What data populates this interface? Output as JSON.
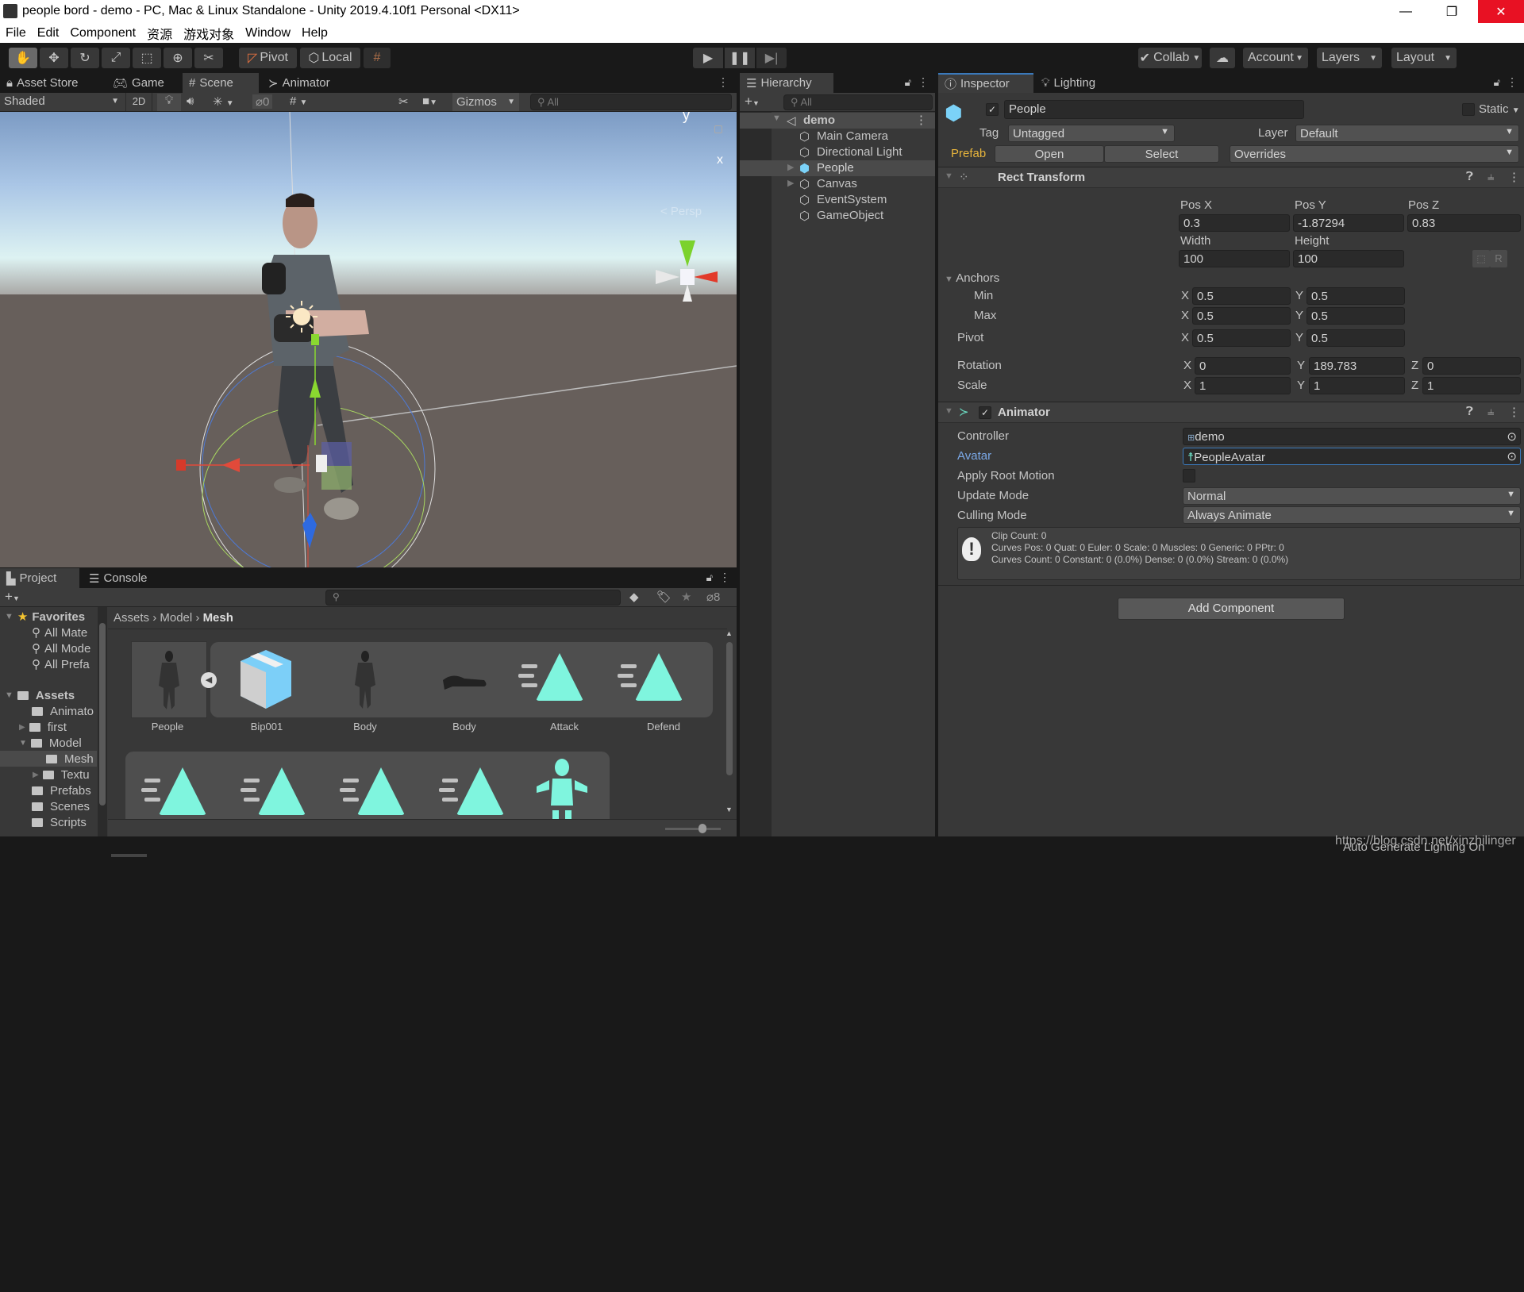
{
  "window": {
    "title": "people bord - demo - PC, Mac & Linux Standalone - Unity 2019.4.10f1 Personal <DX11>",
    "minimize_icon": "minimize-icon",
    "restore_icon": "restore-icon",
    "close_icon": "close-icon",
    "close_color": "#e81123"
  },
  "menu": [
    "File",
    "Edit",
    "Component",
    "资源",
    "游戏对象",
    "Window",
    "Help"
  ],
  "toolbar": {
    "tools": [
      "hand-tool",
      "move-tool",
      "rotate-tool",
      "scale-tool",
      "rect-tool",
      "transform-tool",
      "custom-tool"
    ],
    "pivot_label": "Pivot",
    "local_label": "Local",
    "play_icons": [
      "play-icon",
      "pause-icon",
      "step-icon"
    ],
    "collab_label": "Collab",
    "account_label": "Account",
    "layers_label": "Layers",
    "layout_label": "Layout"
  },
  "scene_panel": {
    "tabs": [
      {
        "label": "Asset Store",
        "icon": "bag-icon"
      },
      {
        "label": "Game",
        "icon": "gamepad-icon"
      },
      {
        "label": "Scene",
        "icon": "grid-icon",
        "active": true
      },
      {
        "label": "Animator",
        "icon": "animator-icon"
      }
    ],
    "shading_mode": "Shaded",
    "mode_2d": "2D",
    "hidden_count": "0",
    "gizmos_label": "Gizmos",
    "search_placeholder": "All",
    "orientation": {
      "y": "y",
      "x": "x",
      "persp": "< Persp"
    }
  },
  "hierarchy": {
    "tab_label": "Hierarchy",
    "search_placeholder": "All",
    "scene": "demo",
    "items": [
      {
        "label": "Main Camera",
        "expandable": false
      },
      {
        "label": "Directional Light",
        "expandable": false
      },
      {
        "label": "People",
        "expandable": true,
        "selected": true,
        "prefab": true
      },
      {
        "label": "Canvas",
        "expandable": true
      },
      {
        "label": "EventSystem",
        "expandable": false
      },
      {
        "label": "GameObject",
        "expandable": false
      }
    ]
  },
  "inspector": {
    "tabs": [
      {
        "label": "Inspector",
        "icon": "info-icon",
        "active": true
      },
      {
        "label": "Lighting",
        "icon": "bulb-icon"
      }
    ],
    "object_name": "People",
    "active": true,
    "static_label": "Static",
    "tag_label": "Tag",
    "tag_value": "Untagged",
    "layer_label": "Layer",
    "layer_value": "Default",
    "prefab_label": "Prefab",
    "prefab_open": "Open",
    "prefab_select": "Select",
    "prefab_overrides": "Overrides",
    "rect_transform": {
      "title": "Rect Transform",
      "pos_x_label": "Pos X",
      "pos_y_label": "Pos Y",
      "pos_z_label": "Pos Z",
      "pos_x": "0.3",
      "pos_y": "-1.87294",
      "pos_z": "0.83",
      "width_label": "Width",
      "height_label": "Height",
      "width": "100",
      "height": "100",
      "r_button": "R",
      "anchors_label": "Anchors",
      "min_label": "Min",
      "max_label": "Max",
      "anchor_min": {
        "x": "0.5",
        "y": "0.5"
      },
      "anchor_max": {
        "x": "0.5",
        "y": "0.5"
      },
      "pivot_label": "Pivot",
      "pivot": {
        "x": "0.5",
        "y": "0.5"
      },
      "rotation_label": "Rotation",
      "rotation": {
        "x": "0",
        "y": "189.783",
        "z": "0"
      },
      "scale_label": "Scale",
      "scale": {
        "x": "1",
        "y": "1",
        "z": "1"
      }
    },
    "animator": {
      "title": "Animator",
      "enabled": true,
      "controller_label": "Controller",
      "controller_value": "demo",
      "avatar_label": "Avatar",
      "avatar_value": "PeopleAvatar",
      "apply_root_motion_label": "Apply Root Motion",
      "apply_root_motion": false,
      "update_mode_label": "Update Mode",
      "update_mode": "Normal",
      "culling_mode_label": "Culling Mode",
      "culling_mode": "Always Animate",
      "info_lines": [
        "Clip Count: 0",
        "Curves Pos: 0 Quat: 0 Euler: 0 Scale: 0 Muscles: 0 Generic: 0 PPtr: 0",
        "Curves Count: 0 Constant: 0 (0.0%) Dense: 0 (0.0%) Stream: 0 (0.0%)"
      ]
    },
    "add_component": "Add Component"
  },
  "project": {
    "tabs": [
      {
        "label": "Project",
        "icon": "folder-icon",
        "active": true
      },
      {
        "label": "Console",
        "icon": "console-icon"
      }
    ],
    "hidden_count": "8",
    "breadcrumb": [
      "Assets",
      "Model",
      "Mesh"
    ],
    "tree": [
      {
        "label": "Favorites",
        "level": 0,
        "bold": true,
        "icon": "star-icon",
        "expanded": true
      },
      {
        "label": "All Mate",
        "level": 1,
        "icon": "search-icon"
      },
      {
        "label": "All Mode",
        "level": 1,
        "icon": "search-icon"
      },
      {
        "label": "All Prefa",
        "level": 1,
        "icon": "search-icon"
      },
      {
        "label": "Assets",
        "level": 0,
        "bold": true,
        "icon": "folder-open-icon",
        "expanded": true
      },
      {
        "label": "Animato",
        "level": 1,
        "icon": "folder-icon"
      },
      {
        "label": "first",
        "level": 1,
        "icon": "folder-icon",
        "expandable": true
      },
      {
        "label": "Model",
        "level": 1,
        "icon": "folder-open-icon",
        "expanded": true
      },
      {
        "label": "Mesh",
        "level": 2,
        "icon": "folder-icon",
        "selected": true
      },
      {
        "label": "Textu",
        "level": 2,
        "icon": "folder-icon",
        "expandable": true
      },
      {
        "label": "Prefabs",
        "level": 1,
        "icon": "folder-icon"
      },
      {
        "label": "Scenes",
        "level": 1,
        "icon": "folder-icon"
      },
      {
        "label": "Scripts",
        "level": 1,
        "icon": "folder-icon"
      }
    ],
    "assets_row1": [
      {
        "label": "People",
        "icon": "model-icon"
      },
      {
        "label": "Bip001",
        "icon": "prefab-box-icon"
      },
      {
        "label": "Body",
        "icon": "model-icon"
      },
      {
        "label": "Body",
        "icon": "mesh-icon"
      },
      {
        "label": "Attack",
        "icon": "animation-clip-icon"
      },
      {
        "label": "Defend",
        "icon": "animation-clip-icon"
      }
    ],
    "assets_row2": [
      {
        "icon": "animation-clip-icon"
      },
      {
        "icon": "animation-clip-icon"
      },
      {
        "icon": "animation-clip-icon"
      },
      {
        "icon": "animation-clip-icon"
      },
      {
        "icon": "avatar-icon"
      }
    ],
    "icon_size_slider": 0.75
  },
  "status": {
    "message": "Auto Generate Lighting On",
    "watermark": "https://blog.csdn.net/xinzhilinger"
  }
}
